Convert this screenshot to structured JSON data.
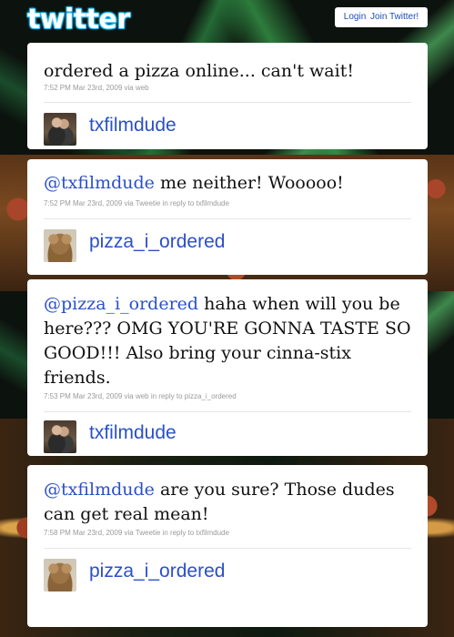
{
  "header": {
    "logo": "twitter",
    "login_label": "Login",
    "join_label": "Join Twitter!"
  },
  "tweets": [
    {
      "mention": "",
      "text": "ordered a pizza online... can't wait!",
      "meta": "7:52 PM Mar 23rd, 2009 via web",
      "author": "txfilmdude"
    },
    {
      "mention": "@txfilmdude",
      "text": " me neither! Wooooo!",
      "meta": "7:52 PM Mar 23rd, 2009 via Tweetie in reply to txfilmdude",
      "author": "pizza_i_ordered"
    },
    {
      "mention": "@pizza_i_ordered",
      "text": " haha when will you be here??? OMG YOU'RE GONNA TASTE SO GOOD!!! Also bring your cinna-stix friends.",
      "meta": "7:53 PM Mar 23rd, 2009 via web in reply to pizza_i_ordered",
      "author": "txfilmdude"
    },
    {
      "mention": "@txfilmdude",
      "text": " are you sure? Those dudes can get real mean!",
      "meta": "7:58 PM Mar 23rd, 2009 via Tweetie in reply to txfilmdude",
      "author": "pizza_i_ordered"
    }
  ],
  "colors": {
    "link": "#2a50c8",
    "meta": "#9a9a9a",
    "logo_glow": "#33ccff"
  }
}
